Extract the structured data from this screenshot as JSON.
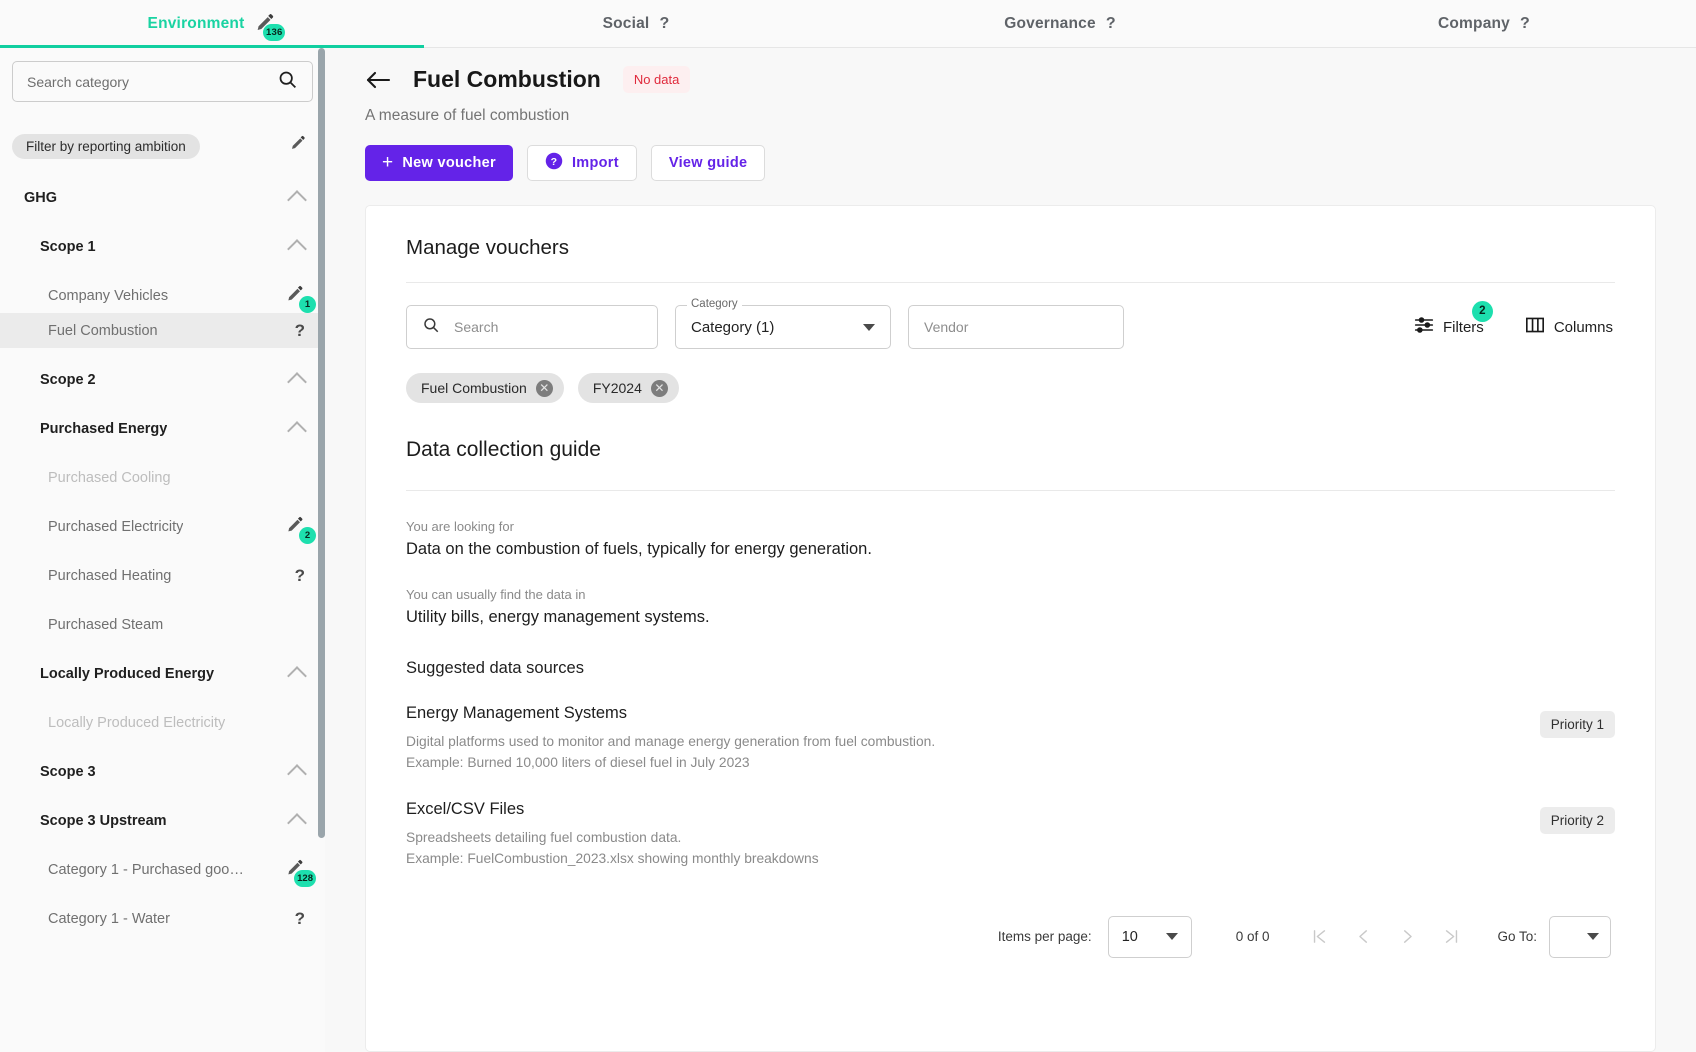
{
  "topbar": {
    "tabs": [
      {
        "label": "Environment",
        "icon": "pencil-icon",
        "badge": "136",
        "active": true,
        "help": false
      },
      {
        "label": "Social",
        "icon": "help-icon",
        "badge": null,
        "active": false,
        "help": true
      },
      {
        "label": "Governance",
        "icon": "help-icon",
        "badge": null,
        "active": false,
        "help": true
      },
      {
        "label": "Company",
        "icon": "help-icon",
        "badge": null,
        "active": false,
        "help": true
      }
    ]
  },
  "sidebar": {
    "search": {
      "placeholder": "Search category",
      "value": "",
      "icon": "search-icon"
    },
    "ambition_filter": {
      "label": "Filter by reporting ambition",
      "edit_icon": "pencil-icon"
    },
    "tree": [
      {
        "label": "GHG",
        "level": 0,
        "chevron": true,
        "badge": null,
        "help": false,
        "selected": false,
        "muted": false,
        "gap": false
      },
      {
        "label": "Scope 1",
        "level": 1,
        "chevron": true,
        "badge": null,
        "help": false,
        "selected": false,
        "muted": false,
        "gap": true
      },
      {
        "label": "Company Vehicles",
        "level": 2,
        "chevron": false,
        "badge": "1",
        "help": false,
        "selected": false,
        "muted": false,
        "gap": true
      },
      {
        "label": "Fuel Combustion",
        "level": 2,
        "chevron": false,
        "badge": null,
        "help": true,
        "selected": true,
        "muted": false,
        "gap": false
      },
      {
        "label": "Scope 2",
        "level": 1,
        "chevron": true,
        "badge": null,
        "help": false,
        "selected": false,
        "muted": false,
        "gap": true
      },
      {
        "label": "Purchased Energy",
        "level": 1,
        "chevron": true,
        "badge": null,
        "help": false,
        "selected": false,
        "muted": false,
        "gap": true
      },
      {
        "label": "Purchased Cooling",
        "level": 2,
        "chevron": false,
        "badge": null,
        "help": false,
        "selected": false,
        "muted": true,
        "gap": true
      },
      {
        "label": "Purchased Electricity",
        "level": 2,
        "chevron": false,
        "badge": "2",
        "help": false,
        "selected": false,
        "muted": false,
        "gap": true
      },
      {
        "label": "Purchased Heating",
        "level": 2,
        "chevron": false,
        "badge": null,
        "help": true,
        "selected": false,
        "muted": false,
        "gap": true
      },
      {
        "label": "Purchased Steam",
        "level": 2,
        "chevron": false,
        "badge": null,
        "help": false,
        "selected": false,
        "muted": false,
        "gap": true
      },
      {
        "label": "Locally Produced Energy",
        "level": 1,
        "chevron": true,
        "badge": null,
        "help": false,
        "selected": false,
        "muted": false,
        "gap": true
      },
      {
        "label": "Locally Produced Electricity",
        "level": 2,
        "chevron": false,
        "badge": null,
        "help": false,
        "selected": false,
        "muted": true,
        "gap": true
      },
      {
        "label": "Scope 3",
        "level": 1,
        "chevron": true,
        "badge": null,
        "help": false,
        "selected": false,
        "muted": false,
        "gap": true
      },
      {
        "label": "Scope 3 Upstream",
        "level": 1,
        "chevron": true,
        "badge": null,
        "help": false,
        "selected": false,
        "muted": false,
        "gap": true
      },
      {
        "label": "Category 1 - Purchased goo…",
        "level": 2,
        "chevron": false,
        "badge": "128",
        "help": false,
        "selected": false,
        "muted": false,
        "gap": true
      },
      {
        "label": "Category 1 - Water",
        "level": 2,
        "chevron": false,
        "badge": null,
        "help": true,
        "selected": false,
        "muted": false,
        "gap": true
      }
    ]
  },
  "page": {
    "back_icon": "arrow-left-icon",
    "title": "Fuel Combustion",
    "status_badge": "No data",
    "subtitle": "A measure of fuel combustion",
    "actions": [
      {
        "label": "New voucher",
        "style": "primary",
        "icon": "plus-icon"
      },
      {
        "label": "Import",
        "style": "outline",
        "icon": "help-circle-icon"
      },
      {
        "label": "View guide",
        "style": "outline",
        "icon": null
      }
    ]
  },
  "vouchers": {
    "section_title": "Manage vouchers",
    "search": {
      "placeholder": "Search",
      "value": "",
      "icon": "search-icon"
    },
    "category": {
      "legend": "Category",
      "value": "Category (1)",
      "icon": "chevron-down-icon"
    },
    "vendor": {
      "placeholder": "Vendor",
      "value": ""
    },
    "filters": {
      "label": "Filters",
      "badge": "2",
      "icon": "filter-icon"
    },
    "columns": {
      "label": "Columns",
      "icon": "columns-icon"
    },
    "chips": [
      {
        "label": "Fuel Combustion",
        "remove_icon": "close-icon"
      },
      {
        "label": "FY2024",
        "remove_icon": "close-icon"
      }
    ]
  },
  "guide": {
    "title": "Data collection guide",
    "looking_for_label": "You are looking for",
    "looking_for_value": "Data on the combustion of fuels, typically for energy generation.",
    "find_data_label": "You can usually find the data in",
    "find_data_value": "Utility bills, energy management systems.",
    "sources_heading": "Suggested data sources",
    "sources": [
      {
        "name": "Energy Management Systems",
        "description": "Digital platforms used to monitor and manage energy generation from fuel combustion.",
        "example": "Example: Burned 10,000 liters of diesel fuel in July 2023",
        "priority": "Priority 1"
      },
      {
        "name": "Excel/CSV Files",
        "description": "Spreadsheets detailing fuel combustion data.",
        "example": "Example: FuelCombustion_2023.xlsx showing monthly breakdowns",
        "priority": "Priority 2"
      }
    ]
  },
  "pagination": {
    "items_per_page_label": "Items per page:",
    "items_per_page_value": "10",
    "range": "0 of 0",
    "first_icon": "first-page-icon",
    "prev_icon": "prev-page-icon",
    "next_icon": "next-page-icon",
    "last_icon": "last-page-icon",
    "goto_label": "Go To:",
    "goto_value": ""
  },
  "colors": {
    "accent_teal": "#1ddfae",
    "primary_purple": "#6423e8",
    "danger_red": "#e02a3c",
    "sidebar_bg": "#fafafa"
  }
}
